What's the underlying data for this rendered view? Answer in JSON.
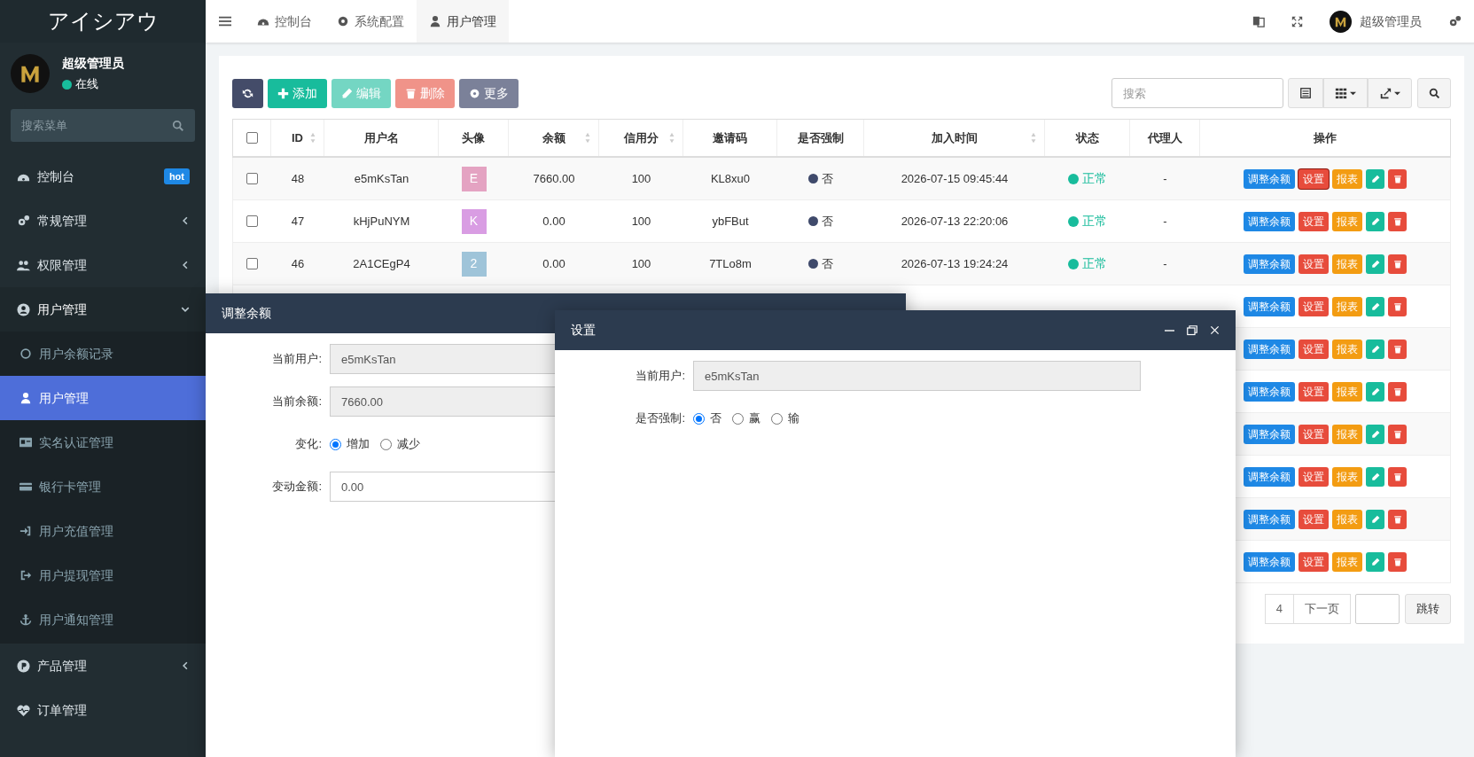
{
  "sidebar": {
    "logo": "アイシアウ",
    "user": {
      "name": "超级管理员",
      "status": "在线"
    },
    "search": {
      "placeholder": "搜索菜单"
    },
    "items": [
      {
        "label": "控制台",
        "badge": "hot",
        "selected": false
      },
      {
        "label": "常规管理",
        "expanded": false,
        "selected": false
      },
      {
        "label": "权限管理",
        "expanded": false,
        "selected": false
      },
      {
        "label": "用户管理",
        "expanded": true,
        "selected": false,
        "children": [
          {
            "label": "用户余额记录",
            "selected": false
          },
          {
            "label": "用户管理",
            "selected": true
          },
          {
            "label": "实名认证管理",
            "selected": false
          },
          {
            "label": "银行卡管理",
            "selected": false
          },
          {
            "label": "用户充值管理",
            "selected": false
          },
          {
            "label": "用户提现管理",
            "selected": false
          },
          {
            "label": "用户通知管理",
            "selected": false
          }
        ]
      },
      {
        "label": "产品管理",
        "expanded": false,
        "selected": false
      },
      {
        "label": "订单管理",
        "selected": false
      }
    ]
  },
  "topbar": {
    "tabs": [
      {
        "label": "控制台",
        "selected": false
      },
      {
        "label": "系统配置",
        "selected": false
      },
      {
        "label": "用户管理",
        "selected": true
      }
    ],
    "user": "超级管理员"
  },
  "toolbar": {
    "buttons": [
      {
        "kind": "refresh",
        "disabled": false
      },
      {
        "kind": "add",
        "label": "添加",
        "disabled": false
      },
      {
        "kind": "edit",
        "label": "编辑",
        "disabled": true
      },
      {
        "kind": "delete",
        "label": "删除",
        "disabled": true
      },
      {
        "kind": "more",
        "label": "更多",
        "disabled": false
      }
    ],
    "search": {
      "placeholder": "搜索"
    }
  },
  "table": {
    "header_checked": false,
    "columns": [
      {
        "label": "ID",
        "sortable": true
      },
      {
        "label": "用户名",
        "sortable": false
      },
      {
        "label": "头像",
        "sortable": false
      },
      {
        "label": "余额",
        "sortable": true
      },
      {
        "label": "信用分",
        "sortable": true
      },
      {
        "label": "邀请码",
        "sortable": false
      },
      {
        "label": "是否强制",
        "sortable": false
      },
      {
        "label": "加入时间",
        "sortable": true
      },
      {
        "label": "状态",
        "sortable": false
      },
      {
        "label": "代理人",
        "sortable": false
      },
      {
        "label": "操作",
        "sortable": false
      }
    ],
    "rows": [
      {
        "checked": false,
        "id": "48",
        "username": "e5mKsTan",
        "avatar": {
          "letter": "E",
          "color": "#e4a3c2"
        },
        "balance": "7660.00",
        "credit": "100",
        "invite": "KL8xu0",
        "forced": "否",
        "joined": "2026-07-15 09:45:44",
        "status": "正常",
        "agent": "-",
        "actions": [
          {
            "kind": "adjust",
            "label": "调整余额",
            "focused": false
          },
          {
            "kind": "settings",
            "label": "设置",
            "focused": true
          },
          {
            "kind": "report",
            "label": "报表",
            "focused": false
          },
          {
            "kind": "edit",
            "focused": false
          },
          {
            "kind": "delete",
            "focused": false
          }
        ]
      },
      {
        "checked": false,
        "id": "47",
        "username": "kHjPuNYM",
        "avatar": {
          "letter": "K",
          "color": "#d99de3"
        },
        "balance": "0.00",
        "credit": "100",
        "invite": "ybFBut",
        "forced": "否",
        "joined": "2026-07-13 22:20:06",
        "status": "正常",
        "agent": "-",
        "actions": [
          {
            "kind": "adjust",
            "label": "调整余额",
            "focused": false
          },
          {
            "kind": "settings",
            "label": "设置",
            "focused": false
          },
          {
            "kind": "report",
            "label": "报表",
            "focused": false
          },
          {
            "kind": "edit",
            "focused": false
          },
          {
            "kind": "delete",
            "focused": false
          }
        ]
      },
      {
        "checked": false,
        "id": "46",
        "username": "2A1CEgP4",
        "avatar": {
          "letter": "2",
          "color": "#9fc4d9"
        },
        "balance": "0.00",
        "credit": "100",
        "invite": "7TLo8m",
        "forced": "否",
        "joined": "2026-07-13 19:24:24",
        "status": "正常",
        "agent": "-",
        "actions": [
          {
            "kind": "adjust",
            "label": "调整余额",
            "focused": false
          },
          {
            "kind": "settings",
            "label": "设置",
            "focused": false
          },
          {
            "kind": "report",
            "label": "报表",
            "focused": false
          },
          {
            "kind": "edit",
            "focused": false
          },
          {
            "kind": "delete",
            "focused": false
          }
        ]
      },
      {
        "actions": [
          {
            "kind": "adjust",
            "label": "调整余额",
            "focused": false
          },
          {
            "kind": "settings",
            "label": "设置",
            "focused": false
          },
          {
            "kind": "report",
            "label": "报表",
            "focused": false
          },
          {
            "kind": "edit",
            "focused": false
          },
          {
            "kind": "delete",
            "focused": false
          }
        ]
      },
      {
        "actions": [
          {
            "kind": "adjust",
            "label": "调整余额",
            "focused": false
          },
          {
            "kind": "settings",
            "label": "设置",
            "focused": false
          },
          {
            "kind": "report",
            "label": "报表",
            "focused": false
          },
          {
            "kind": "edit",
            "focused": false
          },
          {
            "kind": "delete",
            "focused": false
          }
        ]
      },
      {
        "actions": [
          {
            "kind": "adjust",
            "label": "调整余额",
            "focused": false
          },
          {
            "kind": "settings",
            "label": "设置",
            "focused": false
          },
          {
            "kind": "report",
            "label": "报表",
            "focused": false
          },
          {
            "kind": "edit",
            "focused": false
          },
          {
            "kind": "delete",
            "focused": false
          }
        ]
      },
      {
        "actions": [
          {
            "kind": "adjust",
            "label": "调整余额",
            "focused": false
          },
          {
            "kind": "settings",
            "label": "设置",
            "focused": false
          },
          {
            "kind": "report",
            "label": "报表",
            "focused": false
          },
          {
            "kind": "edit",
            "focused": false
          },
          {
            "kind": "delete",
            "focused": false
          }
        ]
      },
      {
        "actions": [
          {
            "kind": "adjust",
            "label": "调整余额",
            "focused": false
          },
          {
            "kind": "settings",
            "label": "设置",
            "focused": false
          },
          {
            "kind": "report",
            "label": "报表",
            "focused": false
          },
          {
            "kind": "edit",
            "focused": false
          },
          {
            "kind": "delete",
            "focused": false
          }
        ]
      },
      {
        "actions": [
          {
            "kind": "adjust",
            "label": "调整余额",
            "focused": false
          },
          {
            "kind": "settings",
            "label": "设置",
            "focused": false
          },
          {
            "kind": "report",
            "label": "报表",
            "focused": false
          },
          {
            "kind": "edit",
            "focused": false
          },
          {
            "kind": "delete",
            "focused": false
          }
        ]
      },
      {
        "actions": [
          {
            "kind": "adjust",
            "label": "调整余额",
            "focused": false
          },
          {
            "kind": "settings",
            "label": "设置",
            "focused": false
          },
          {
            "kind": "report",
            "label": "报表",
            "focused": false
          },
          {
            "kind": "edit",
            "focused": false
          },
          {
            "kind": "delete",
            "focused": false
          }
        ]
      }
    ]
  },
  "pagination": {
    "pages": [
      "4"
    ],
    "next": "下一页",
    "jump": "跳转"
  },
  "dialogs": [
    {
      "title": "调整余额",
      "fields": [
        {
          "kind": "readonly",
          "label": "当前用户:",
          "value": "e5mKsTan"
        },
        {
          "kind": "readonly",
          "label": "当前余额:",
          "value": "7660.00"
        },
        {
          "kind": "radio",
          "label": "变化:",
          "options": [
            {
              "label": "增加",
              "selected": true
            },
            {
              "label": "减少",
              "selected": false
            }
          ]
        },
        {
          "kind": "input",
          "label": "变动金额:",
          "value": "0.00"
        }
      ]
    },
    {
      "title": "设置",
      "fields": [
        {
          "kind": "readonly",
          "label": "当前用户:",
          "value": "e5mKsTan"
        },
        {
          "kind": "radio",
          "label": "是否强制:",
          "options": [
            {
              "label": "否",
              "selected": true
            },
            {
              "label": "赢",
              "selected": false
            },
            {
              "label": "输",
              "selected": false
            }
          ]
        }
      ]
    }
  ]
}
